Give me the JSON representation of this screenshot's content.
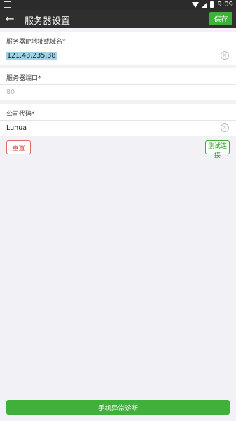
{
  "status_bar": {
    "time": "9:09"
  },
  "app_bar": {
    "title": "服务器设置",
    "save_label": "保存"
  },
  "fields": {
    "server_address": {
      "label": "服务器IP地址或域名*",
      "value": "121.43.235.38"
    },
    "server_port": {
      "label": "服务器端口*",
      "placeholder": "80"
    },
    "company_code": {
      "label": "公司代码*",
      "value": "Luhua"
    }
  },
  "actions": {
    "reset_label": "重置",
    "test_label": "测试连接",
    "diagnose_label": "手机异常诊断"
  },
  "colors": {
    "accent": "#3fb13a",
    "danger": "#d33333",
    "appbar": "#2f2f2f",
    "background": "#f1f1f6"
  },
  "icons": {
    "back": "arrow-left-icon",
    "clear": "clear-circle-icon"
  }
}
